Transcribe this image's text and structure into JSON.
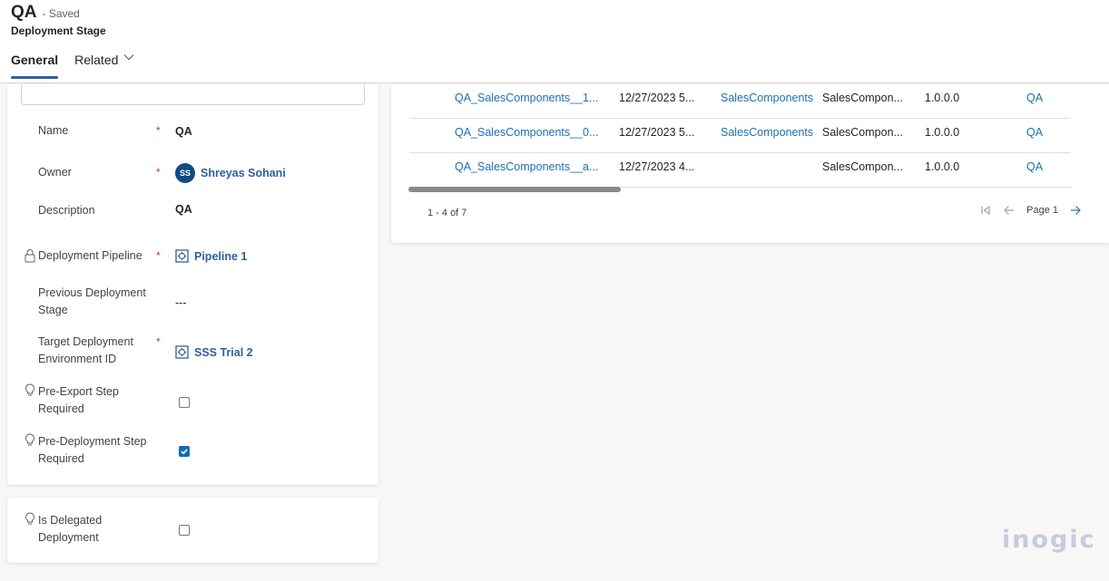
{
  "header": {
    "record_title": "QA",
    "save_status": "- Saved",
    "entity_name": "Deployment Stage",
    "tabs": [
      {
        "label": "General",
        "active": true
      },
      {
        "label": "Related",
        "active": false,
        "has_dropdown": true
      }
    ]
  },
  "form": {
    "fields": [
      {
        "label": "Name",
        "required": true,
        "value": "QA",
        "type": "text"
      },
      {
        "label": "Owner",
        "required": true,
        "value": "Shreyas Sohani",
        "avatar_initials": "SS",
        "type": "lookup-user"
      },
      {
        "label": "Description",
        "required": false,
        "value": "QA",
        "type": "text"
      },
      {
        "label": "Deployment Pipeline",
        "required": true,
        "value": "Pipeline 1",
        "type": "lookup",
        "icon": "lock-icon"
      },
      {
        "label": "Previous Deployment Stage",
        "required": false,
        "value": "---",
        "type": "text"
      },
      {
        "label": "Target Deployment Environment ID",
        "required": true,
        "value": "SSS Trial 2",
        "type": "lookup"
      },
      {
        "label": "Pre-Export Step Required",
        "required": false,
        "checked": false,
        "type": "checkbox",
        "icon": "lightbulb-icon"
      },
      {
        "label": "Pre-Deployment Step Required",
        "required": false,
        "checked": true,
        "type": "checkbox",
        "icon": "lightbulb-icon"
      }
    ],
    "delegated": {
      "label": "Is Delegated Deployment",
      "checked": false,
      "icon": "lightbulb-icon"
    },
    "required_marker": "*"
  },
  "grid": {
    "rows": [
      [
        "QA_SalesComponents__1...",
        "12/27/2023 5...",
        "SalesComponents",
        "SalesCompon...",
        "1.0.0.0",
        "QA"
      ],
      [
        "QA_SalesComponents__0...",
        "12/27/2023 5...",
        "SalesComponents",
        "SalesCompon...",
        "1.0.0.0",
        "QA"
      ],
      [
        "QA_SalesComponents__a...",
        "12/27/2023 4...",
        "",
        "SalesCompon...",
        "1.0.0.0",
        "QA"
      ]
    ],
    "record_count": "1 - 4 of 7",
    "page_label": "Page 1"
  },
  "watermark": "inogic",
  "colors": {
    "accent": "#2f5f9e",
    "link": "#1e6fb3",
    "required": "#c4314b",
    "checkbox_checked": "#0f6cbd",
    "avatar": "#0f4c81"
  }
}
